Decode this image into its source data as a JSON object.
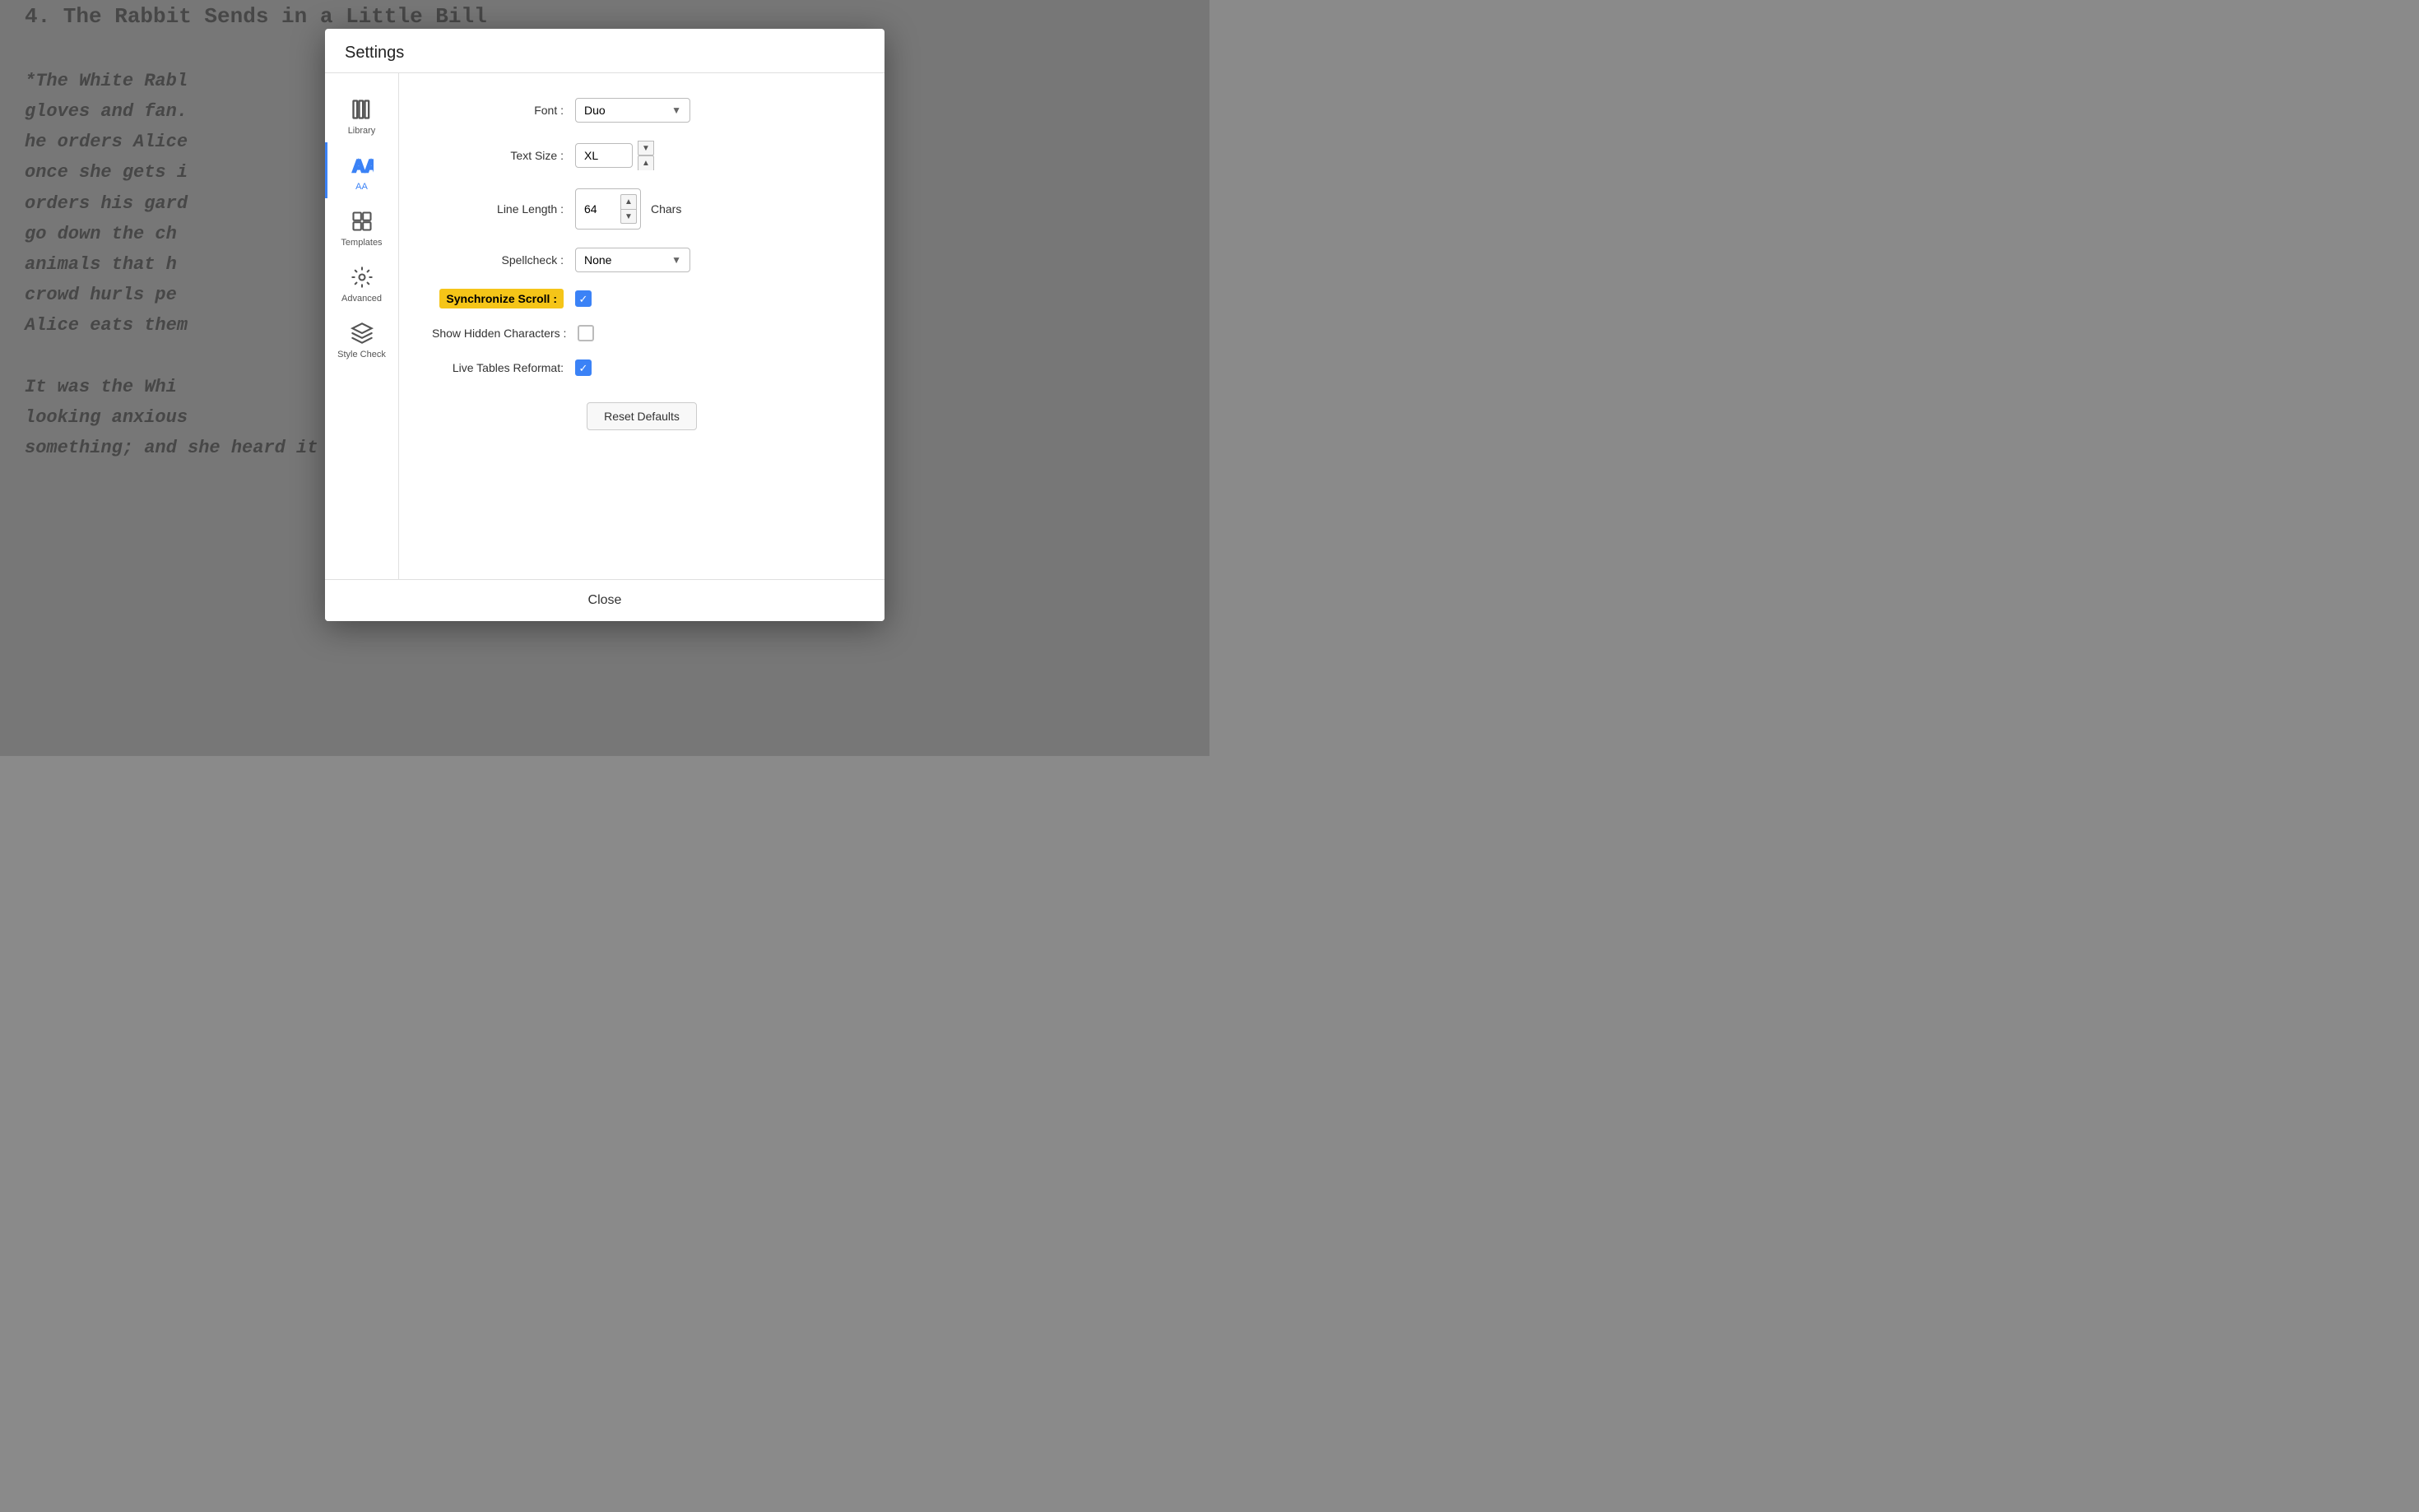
{
  "background": {
    "lines": [
      "4. The Rabbit Sends in a Little Bill",
      "",
      "*The White Rabl                              Duchess's",
      "gloves and fan.                         t, Mary Ann,",
      "he orders Alice                         e them, but",
      "once she gets i                         ified Rabbit",
      "orders his gard                         n the roof and",
      "go down the ch                          ices of",
      "animals that h                          arm. The",
      "crowd hurls pe                          tle cakes.",
      "Alice eats them                                  ze.*",
      "",
      "It was the Whi                          gain, and",
      "looking anxious                                  lost",
      "something; and she heard it muttering to itself \"The Duchess!"
    ]
  },
  "modal": {
    "title": "Settings",
    "sidebar": {
      "items": [
        {
          "id": "library",
          "label": "Library",
          "active": false
        },
        {
          "id": "font",
          "label": "AA",
          "active": true
        },
        {
          "id": "templates",
          "label": "Templates",
          "active": false
        },
        {
          "id": "advanced",
          "label": "Advanced",
          "active": false
        },
        {
          "id": "stylecheck",
          "label": "Style Check",
          "active": false
        }
      ]
    },
    "form": {
      "font_label": "Font :",
      "font_value": "Duo",
      "text_size_label": "Text Size :",
      "text_size_value": "XL",
      "line_length_label": "Line Length :",
      "line_length_value": "64",
      "line_length_unit": "Chars",
      "spellcheck_label": "Spellcheck :",
      "spellcheck_value": "None",
      "sync_scroll_label": "Synchronize Scroll :",
      "sync_scroll_checked": true,
      "show_hidden_label": "Show Hidden Characters :",
      "show_hidden_checked": false,
      "live_tables_label": "Live Tables Reformat:",
      "live_tables_checked": true,
      "reset_label": "Reset Defaults"
    },
    "close_label": "Close"
  }
}
